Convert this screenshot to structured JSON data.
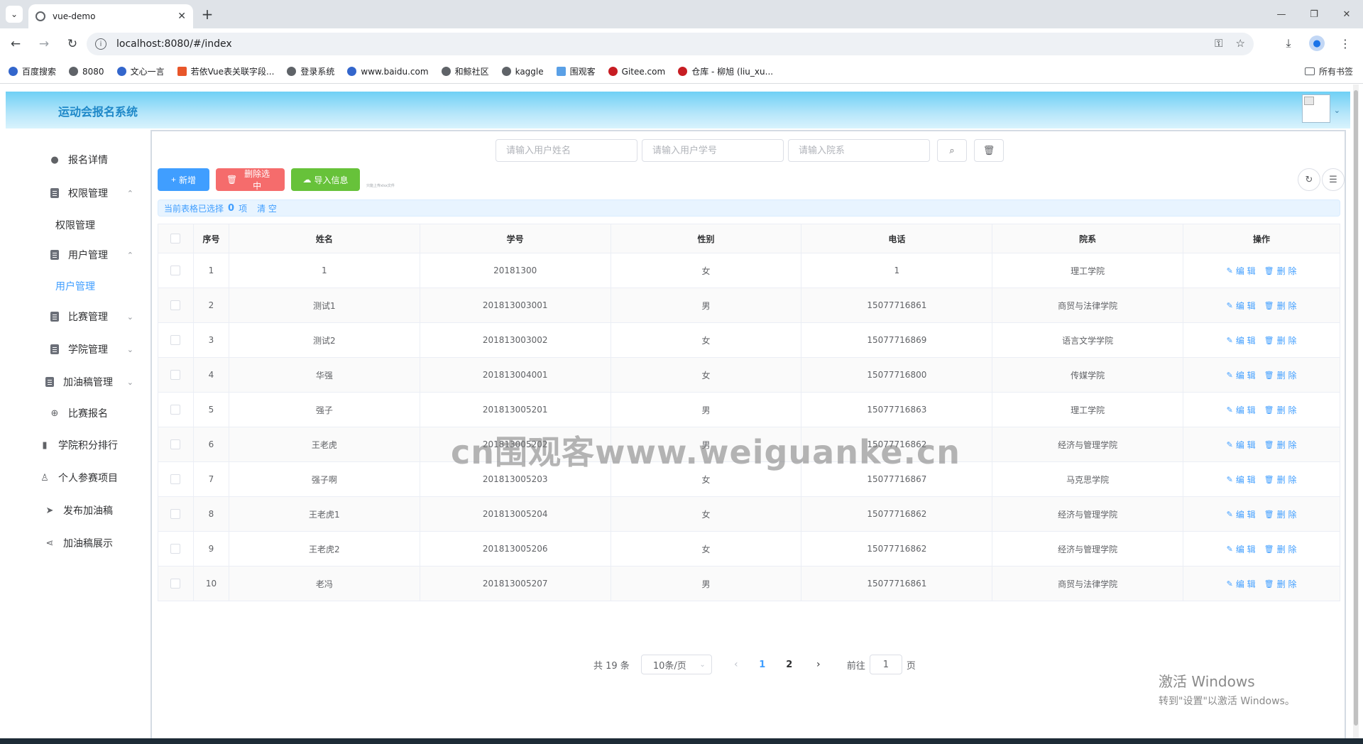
{
  "browser": {
    "tab_title": "vue-demo",
    "url": "localhost:8080/#/index",
    "bookmarks": [
      "百度搜索",
      "8080",
      "文心一言",
      "若依Vue表关联字段...",
      "登录系统",
      "www.baidu.com",
      "和鲸社区",
      "kaggle",
      "围观客",
      "Gitee.com",
      "仓库 - 柳旭 (liu_xu..."
    ],
    "bookmarks_folder": "所有书签"
  },
  "app": {
    "title": "运动会报名系统"
  },
  "sidebar": {
    "items": [
      {
        "label": "报名详情",
        "icon": "pin-icon"
      },
      {
        "label": "权限管理",
        "icon": "doc-icon",
        "caret": "up"
      },
      {
        "label": "权限管理",
        "sub": true
      },
      {
        "label": "用户管理",
        "icon": "doc-icon",
        "caret": "up"
      },
      {
        "label": "用户管理",
        "sub": true,
        "active": true
      },
      {
        "label": "比赛管理",
        "icon": "doc-icon",
        "caret": "down"
      },
      {
        "label": "学院管理",
        "icon": "doc-icon",
        "caret": "down"
      },
      {
        "label": "加油稿管理",
        "icon": "doc-icon",
        "caret": "down"
      },
      {
        "label": "比赛报名",
        "icon": "plus-circle-icon"
      },
      {
        "label": "学院积分排行",
        "icon": "bar-chart-icon"
      },
      {
        "label": "个人参赛项目",
        "icon": "user-icon"
      },
      {
        "label": "发布加油稿",
        "icon": "send-icon"
      },
      {
        "label": "加油稿展示",
        "icon": "share-icon"
      }
    ]
  },
  "search": {
    "name_placeholder": "请输入用户姓名",
    "id_placeholder": "请输入用户学号",
    "dept_placeholder": "请输入院系"
  },
  "actions": {
    "add_label": "新增",
    "delete_label": "删除选中",
    "import_label": "导入信息",
    "tiny_note": "只能上传xlsx文件"
  },
  "selection": {
    "prefix": "当前表格已选择",
    "count": "0",
    "suffix": "项",
    "clear": "清 空"
  },
  "table": {
    "headers": [
      "序号",
      "姓名",
      "学号",
      "性别",
      "电话",
      "院系",
      "操作"
    ],
    "edit_label": "编 辑",
    "delete_label": "删 除",
    "rows": [
      {
        "no": "1",
        "name": "1",
        "sid": "20181300",
        "gender": "女",
        "phone": "1",
        "dept": "理工学院"
      },
      {
        "no": "2",
        "name": "测试1",
        "sid": "201813003001",
        "gender": "男",
        "phone": "15077716861",
        "dept": "商贸与法律学院"
      },
      {
        "no": "3",
        "name": "测试2",
        "sid": "201813003002",
        "gender": "女",
        "phone": "15077716869",
        "dept": "语言文学学院"
      },
      {
        "no": "4",
        "name": "华强",
        "sid": "201813004001",
        "gender": "女",
        "phone": "15077716800",
        "dept": "传媒学院"
      },
      {
        "no": "5",
        "name": "强子",
        "sid": "201813005201",
        "gender": "男",
        "phone": "15077716863",
        "dept": "理工学院"
      },
      {
        "no": "6",
        "name": "王老虎",
        "sid": "201813005202",
        "gender": "男",
        "phone": "15077716862",
        "dept": "经济与管理学院"
      },
      {
        "no": "7",
        "name": "强子啊",
        "sid": "201813005203",
        "gender": "女",
        "phone": "15077716867",
        "dept": "马克思学院"
      },
      {
        "no": "8",
        "name": "王老虎1",
        "sid": "201813005204",
        "gender": "女",
        "phone": "15077716862",
        "dept": "经济与管理学院"
      },
      {
        "no": "9",
        "name": "王老虎2",
        "sid": "201813005206",
        "gender": "女",
        "phone": "15077716862",
        "dept": "经济与管理学院"
      },
      {
        "no": "10",
        "name": "老冯",
        "sid": "201813005207",
        "gender": "男",
        "phone": "15077716861",
        "dept": "商贸与法律学院"
      }
    ]
  },
  "pagination": {
    "total": "共 19 条",
    "page_size": "10条/页",
    "pages": [
      "1",
      "2"
    ],
    "current": "1",
    "goto_prefix": "前往",
    "goto_value": "1",
    "goto_suffix": "页"
  },
  "overlay": {
    "watermark": "cn围观客www.weiguanke.cn",
    "activate_title": "激活 Windows",
    "activate_sub": "转到\"设置\"以激活 Windows。"
  },
  "colors": {
    "primary": "#409eff",
    "danger": "#f56c6c",
    "success": "#67c23a",
    "header_gradient_top": "#6fd0f5"
  }
}
